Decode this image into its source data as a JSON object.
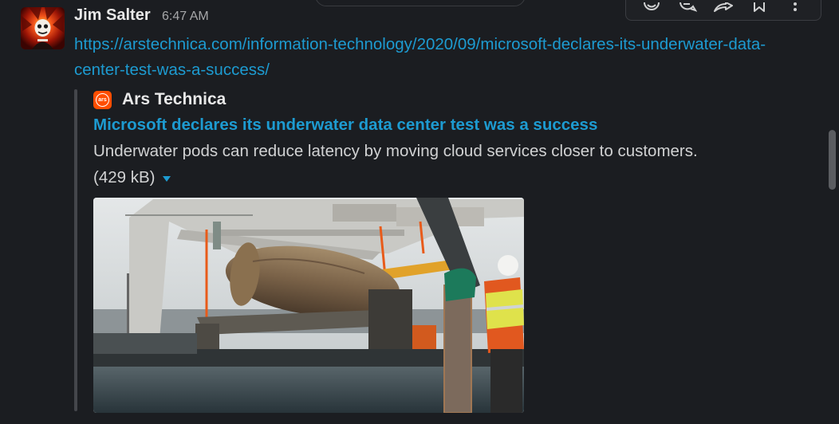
{
  "message": {
    "sender": "Jim Salter",
    "time": "6:47 AM",
    "link_url": "https://arstechnica.com/information-technology/2020/09/microsoft-declares-its-underwater-data-center-test-was-a-success/",
    "link_text": "https://arstechnica.com/information-technology/2020/09/microsoft-declares-its-underwater-data-center-test-was-a-success/"
  },
  "unfurl": {
    "site_name": "Ars Technica",
    "site_icon_text": "ars",
    "title": "Microsoft declares its underwater data center test was a success",
    "description": "Underwater pods can reduce latency by moving cloud services closer to customers.",
    "file_size": "(429 kB)"
  },
  "actions": [
    {
      "icon": "emoji-reaction-icon"
    },
    {
      "icon": "reply-in-thread-icon"
    },
    {
      "icon": "share-message-icon"
    },
    {
      "icon": "bookmark-icon"
    },
    {
      "icon": "more-actions-icon"
    }
  ],
  "colors": {
    "background": "#1b1d21",
    "link": "#1d9bd1",
    "text": "#d1d2d3",
    "site_icon": "#ff4e00"
  }
}
